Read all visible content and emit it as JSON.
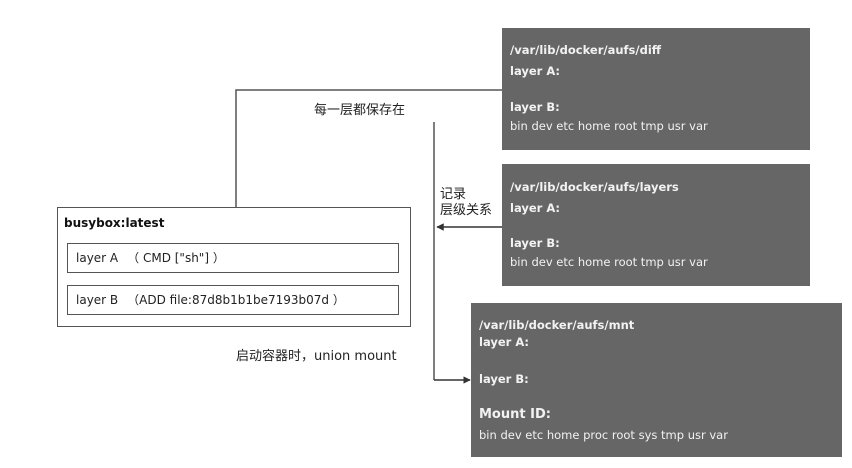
{
  "image_box": {
    "title": "busybox:latest",
    "layers": [
      {
        "name": "layer A",
        "detail": "（ CMD [\"sh\"] ）"
      },
      {
        "name": "layer B",
        "detail": "（ADD file:87d8b1b1be7193b07d ）"
      }
    ]
  },
  "dirs": {
    "diff": {
      "path": "/var/lib/docker/aufs/diff",
      "layer_a": "layer A:",
      "layer_b": "layer B:",
      "files": "bin dev etc home root tmp usr var"
    },
    "layers": {
      "path": "/var/lib/docker/aufs/layers",
      "layer_a": "layer A:",
      "layer_b": "layer B:",
      "files": "bin dev etc home root tmp usr var"
    },
    "mnt": {
      "path": "/var/lib/docker/aufs/mnt",
      "layer_a": "layer A:",
      "layer_b": "layer B:",
      "mount_id": "Mount ID:",
      "files": "bin dev etc home proc root sys tmp usr var"
    }
  },
  "labels": {
    "save": "每一层都保存在",
    "record_line1": "记录",
    "record_line2": "层级关系",
    "union": "启动容器时，union mount"
  },
  "colors": {
    "dir_box_fill": "#666666",
    "dir_box_text": "#f2f2f2",
    "line": "#555555"
  }
}
